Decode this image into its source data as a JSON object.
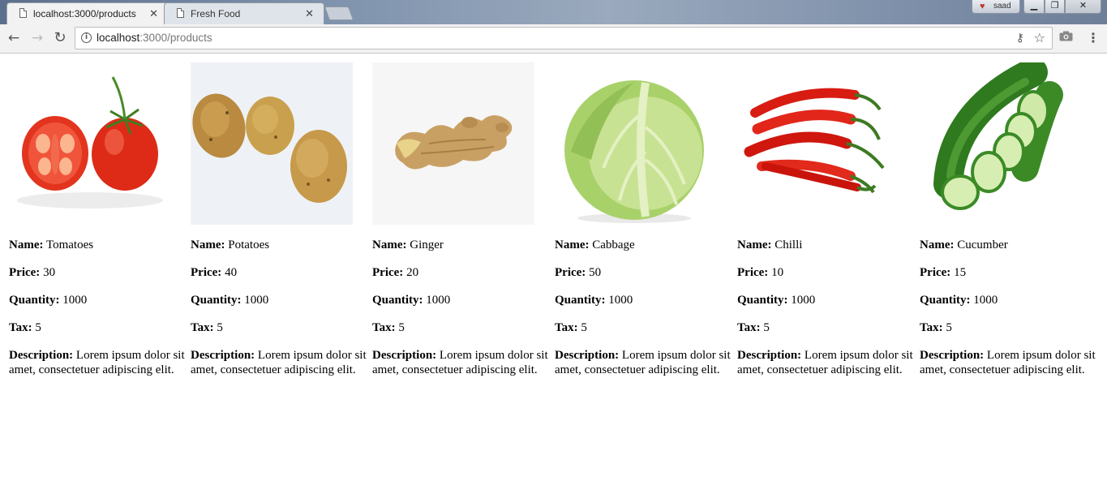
{
  "browser": {
    "tabs": [
      {
        "title": "localhost:3000/products",
        "active": true
      },
      {
        "title": "Fresh Food",
        "active": false
      }
    ],
    "profile_name": "saad",
    "url_host": "localhost",
    "url_path": ":3000/products"
  },
  "labels": {
    "name": "Name:",
    "price": "Price:",
    "quantity": "Quantity:",
    "tax": "Tax:",
    "description": "Description:"
  },
  "products": [
    {
      "name": "Tomatoes",
      "price": "30",
      "quantity": "1000",
      "tax": "5",
      "description": "Lorem ipsum dolor sit amet, consectetuer adipiscing elit.",
      "image": "tomato-image"
    },
    {
      "name": "Potatoes",
      "price": "40",
      "quantity": "1000",
      "tax": "5",
      "description": "Lorem ipsum dolor sit amet, consectetuer adipiscing elit.",
      "image": "potato-image"
    },
    {
      "name": "Ginger",
      "price": "20",
      "quantity": "1000",
      "tax": "5",
      "description": "Lorem ipsum dolor sit amet, consectetuer adipiscing elit.",
      "image": "ginger-image"
    },
    {
      "name": "Cabbage",
      "price": "50",
      "quantity": "1000",
      "tax": "5",
      "description": "Lorem ipsum dolor sit amet, consectetuer adipiscing elit.",
      "image": "cabbage-image"
    },
    {
      "name": "Chilli",
      "price": "10",
      "quantity": "1000",
      "tax": "5",
      "description": "Lorem ipsum dolor sit amet, consectetuer adipiscing elit.",
      "image": "chilli-image"
    },
    {
      "name": "Cucumber",
      "price": "15",
      "quantity": "1000",
      "tax": "5",
      "description": "Lorem ipsum dolor sit amet, consectetuer adipiscing elit.",
      "image": "cucumber-image"
    }
  ]
}
